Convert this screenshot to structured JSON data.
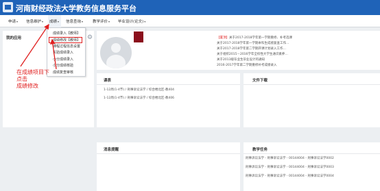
{
  "header": {
    "title": "河南财经政法大学教务信息服务平台"
  },
  "nav": [
    {
      "label": "申请",
      "caret": "▾"
    },
    {
      "label": "信息维护",
      "caret": "▾"
    },
    {
      "label": "成绩",
      "caret": "▾"
    },
    {
      "label": "信息查询",
      "caret": "▾"
    },
    {
      "label": "教学评价",
      "caret": "▾"
    },
    {
      "label": "毕业设计(论文)",
      "caret": "▾"
    }
  ],
  "dropdown": {
    "items": [
      "成绩录入【教师】",
      "成绩修改【教师】",
      "课程过程信息设置",
      "实验成绩录入",
      "小分成绩录入",
      "小分成绩核验",
      "成绩复查审核"
    ]
  },
  "my_apps": {
    "title": "我的应用"
  },
  "annotation": {
    "lines": [
      "在成绩项目下",
      "点击",
      "成绩修改"
    ]
  },
  "news": {
    "items": [
      {
        "tag": "【置顶】",
        "text": "关于2017-2018学年第一学期重修、补考选课"
      },
      {
        "tag": "",
        "text": "关于2017-2018学年第一学期本科生成绩复查工作…"
      },
      {
        "tag": "",
        "text": "关于2017-2018学年第二学期开课计划录入工作…"
      },
      {
        "tag": "",
        "text": "关于组织2015－2016学年全校性大学生通识素养…"
      },
      {
        "tag": "",
        "text": "关于2013级毕业生毕业设计的通知"
      },
      {
        "tag": "",
        "text": "2016-2017学年第二学期重修补考成绩录入"
      }
    ]
  },
  "courses": {
    "title": "课表",
    "items": [
      "1-12周(1-4节) / 刑事诉讼法学 / 综合楼北区-教404",
      "1-12周(1-4节) / 刑事诉讼法学 / 综合楼北区-教406"
    ]
  },
  "downloads": {
    "title": "文件下载"
  },
  "reminders": {
    "title": "消息提醒"
  },
  "tasks": {
    "title": "教学任务",
    "items": [
      "刑事诉讼法学  -  刑事诉讼法学 - 00144004 - 刑事诉讼法学0002",
      "刑事诉讼法学  -  刑事诉讼法学 - 00144004 - 刑事诉讼法学0003",
      "刑事诉讼法学  -  刑事诉讼法学 - 00144004 - 刑事诉讼法学0004"
    ]
  },
  "colors": {
    "header": "#1f63b8",
    "accent": "#e02020",
    "background": "#eceff2"
  }
}
